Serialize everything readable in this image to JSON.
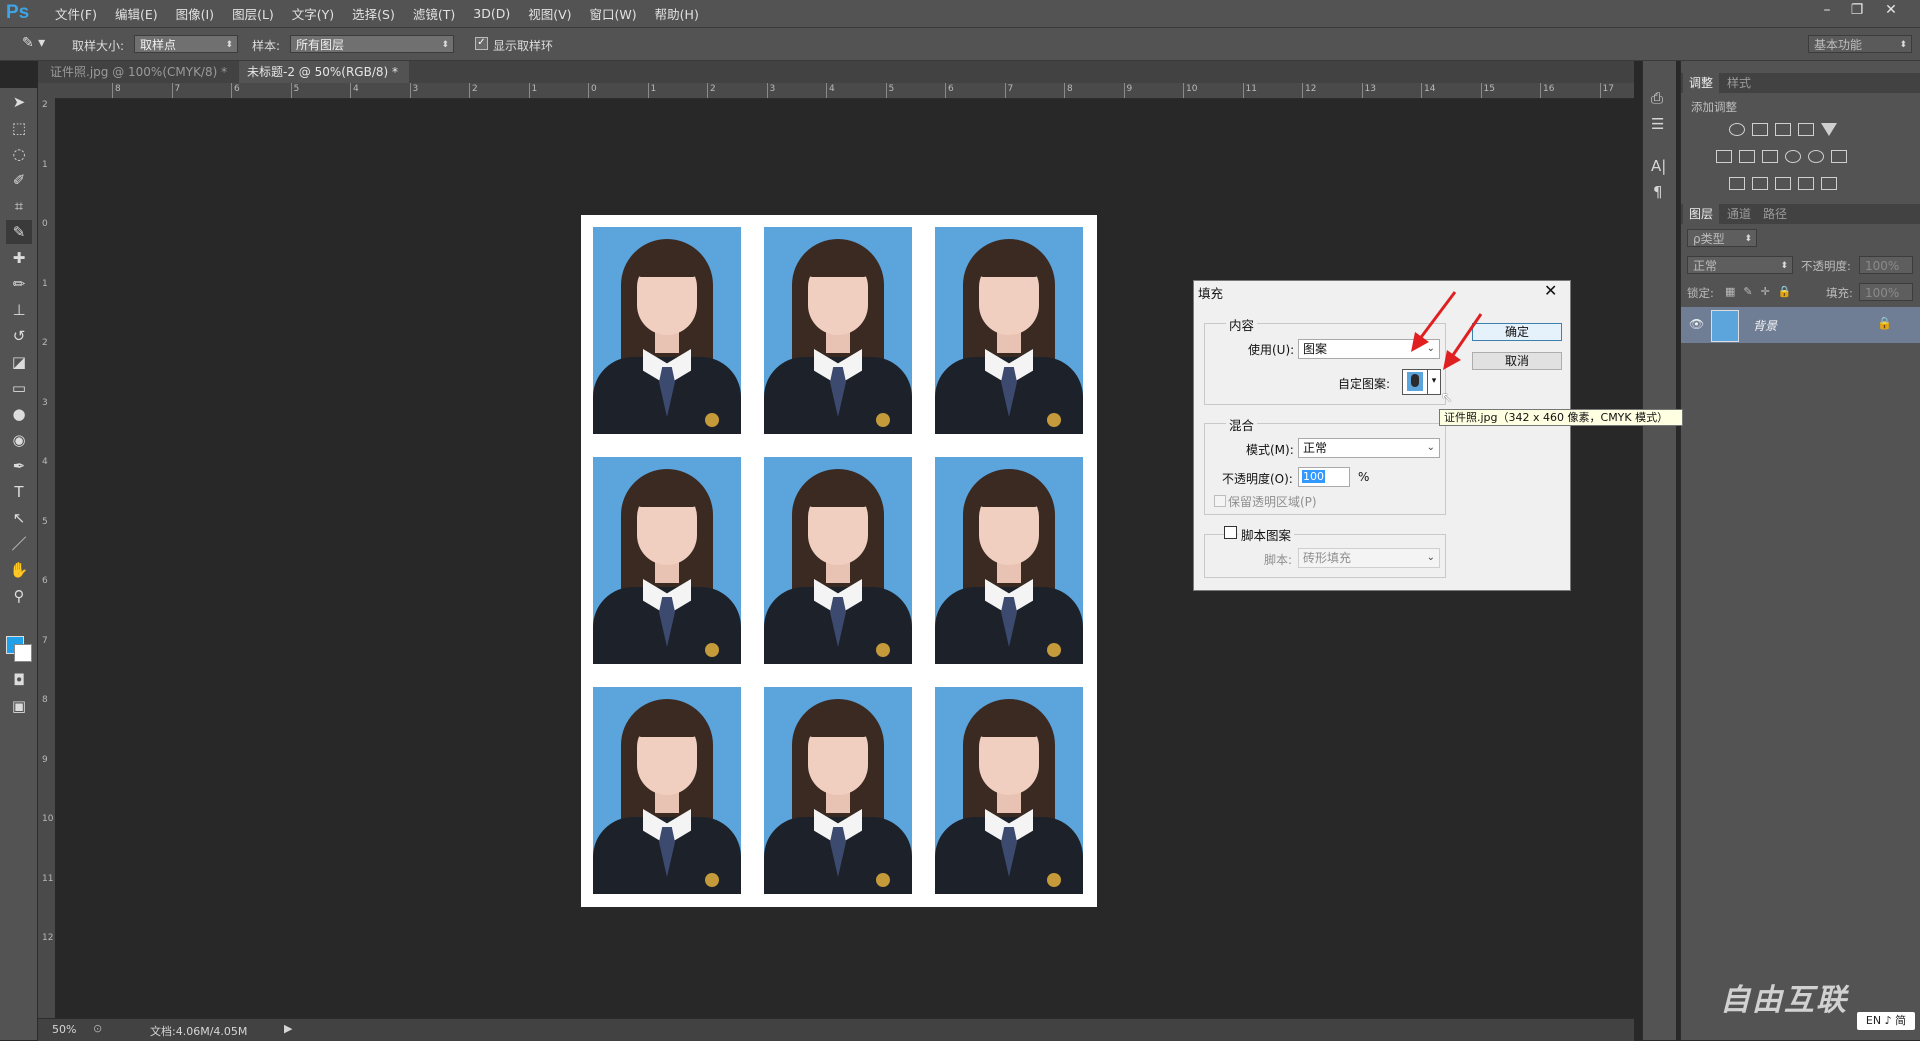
{
  "app": {
    "logo": "Ps"
  },
  "menu": [
    "文件(F)",
    "编辑(E)",
    "图像(I)",
    "图层(L)",
    "文字(Y)",
    "选择(S)",
    "滤镜(T)",
    "3D(D)",
    "视图(V)",
    "窗口(W)",
    "帮助(H)"
  ],
  "window_controls": {
    "minimize": "–",
    "restore": "❐",
    "close": "✕"
  },
  "options": {
    "sample_size_label": "取样大小:",
    "sample_size_value": "取样点",
    "sample_label": "样本:",
    "sample_value": "所有图层",
    "show_ring_label": "显示取样环",
    "show_ring_checked": true,
    "workspace": "基本功能"
  },
  "tabs": [
    {
      "label": "证件照.jpg @ 100%(CMYK/8) *",
      "close": "×"
    },
    {
      "label": "未标题-2 @ 50%(RGB/8) *",
      "close": "×"
    }
  ],
  "ruler_h": [
    "8",
    "7",
    "6",
    "5",
    "4",
    "3",
    "2",
    "1",
    "0",
    "1",
    "2",
    "3",
    "4",
    "5",
    "6",
    "7",
    "8",
    "9",
    "10",
    "11",
    "12",
    "13",
    "14",
    "15",
    "16",
    "17"
  ],
  "ruler_v": [
    "2",
    "1",
    "0",
    "1",
    "2",
    "3",
    "4",
    "5",
    "6",
    "7",
    "8",
    "9",
    "10",
    "11",
    "12"
  ],
  "status": {
    "zoom": "50%",
    "doc": "文档:4.06M/4.05M"
  },
  "adjust_panel": {
    "tabs": [
      "调整",
      "样式"
    ],
    "title": "添加调整"
  },
  "layers_panel": {
    "tabs": [
      "图层",
      "通道",
      "路径"
    ],
    "filter": "ρ类型",
    "blend": "正常",
    "opacity_label": "不透明度:",
    "opacity": "100%",
    "lock_label": "锁定:",
    "fill_label": "填充:",
    "fill": "100%",
    "layer_name": "背景"
  },
  "dialog": {
    "title": "填充",
    "content_legend": "内容",
    "use_label": "使用(U):",
    "use_value": "图案",
    "custom_pattern_label": "自定图案:",
    "ok": "确定",
    "cancel": "取消",
    "blend_legend": "混合",
    "mode_label": "模式(M):",
    "mode_value": "正常",
    "opacity_label": "不透明度(O):",
    "opacity_value": "100",
    "percent": "%",
    "preserve_label": "保留透明区域(P)",
    "script_label": "脚本图案",
    "script_field_label": "脚本:",
    "script_value": "砖形填充"
  },
  "tooltip": "证件照.jpg（342 x 460 像素，CMYK 模式）",
  "watermark": "自由互联",
  "ime": "EN ♪ 简",
  "colors": {
    "accent": "#3ca5e8",
    "photo_bg": "#5ba4dc",
    "arrow": "#e02020"
  }
}
